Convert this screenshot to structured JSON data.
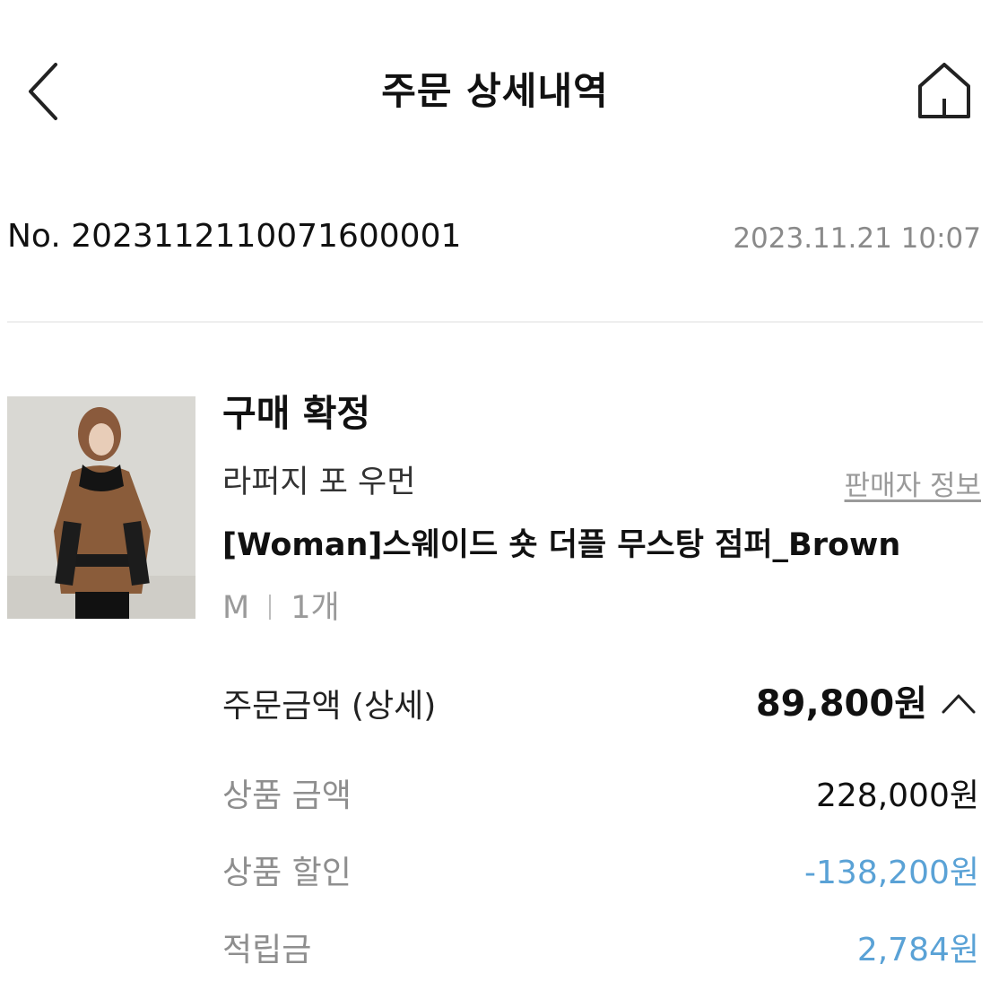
{
  "header": {
    "title": "주문 상세내역",
    "back_icon": "chevron-left-icon",
    "home_icon": "home-icon"
  },
  "order": {
    "number": "No. 2023112110071600001",
    "date": "2023.11.21 10:07"
  },
  "item": {
    "status": "구매 확정",
    "brand": "라퍼지 포 우먼",
    "seller_link": "판매자 정보",
    "name": "[Woman]스웨이드 숏 더플 무스탕 점퍼_Brown",
    "size": "M",
    "quantity": "1개"
  },
  "price": {
    "label": "주문금액 (상세)",
    "total": "89,800원",
    "toggle_icon": "chevron-up-icon",
    "rows": [
      {
        "label": "상품 금액",
        "value": "228,000원",
        "color": "#111111"
      },
      {
        "label": "상품 할인",
        "value": "-138,200원",
        "color": "#5aa2d6"
      },
      {
        "label": "적립금",
        "value": "2,784원",
        "color": "#5aa2d6"
      }
    ]
  }
}
